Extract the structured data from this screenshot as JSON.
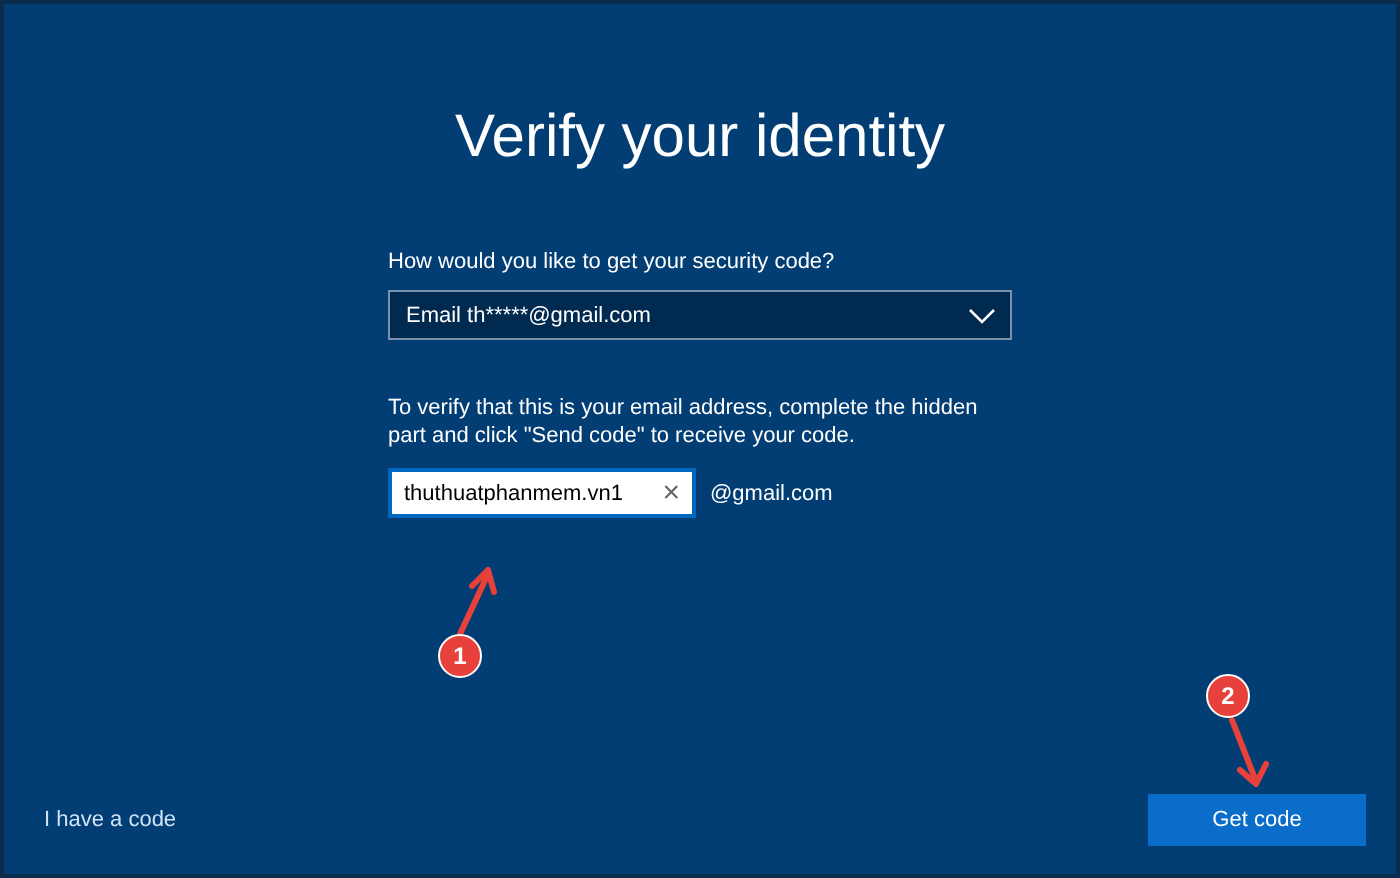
{
  "title": "Verify your identity",
  "method": {
    "label": "How would you like to get your security code?",
    "value": "Email th*****@gmail.com"
  },
  "verify": {
    "instructions": "To verify that this is your email address, complete the hidden part and click \"Send code\" to receive your code.",
    "value": "thuthuatphanmem.vn1",
    "clear": "×",
    "suffix": "@gmail.com"
  },
  "link": "I have a code",
  "button": "Get code",
  "steps": [
    {
      "label": "1"
    },
    {
      "label": "2"
    }
  ]
}
